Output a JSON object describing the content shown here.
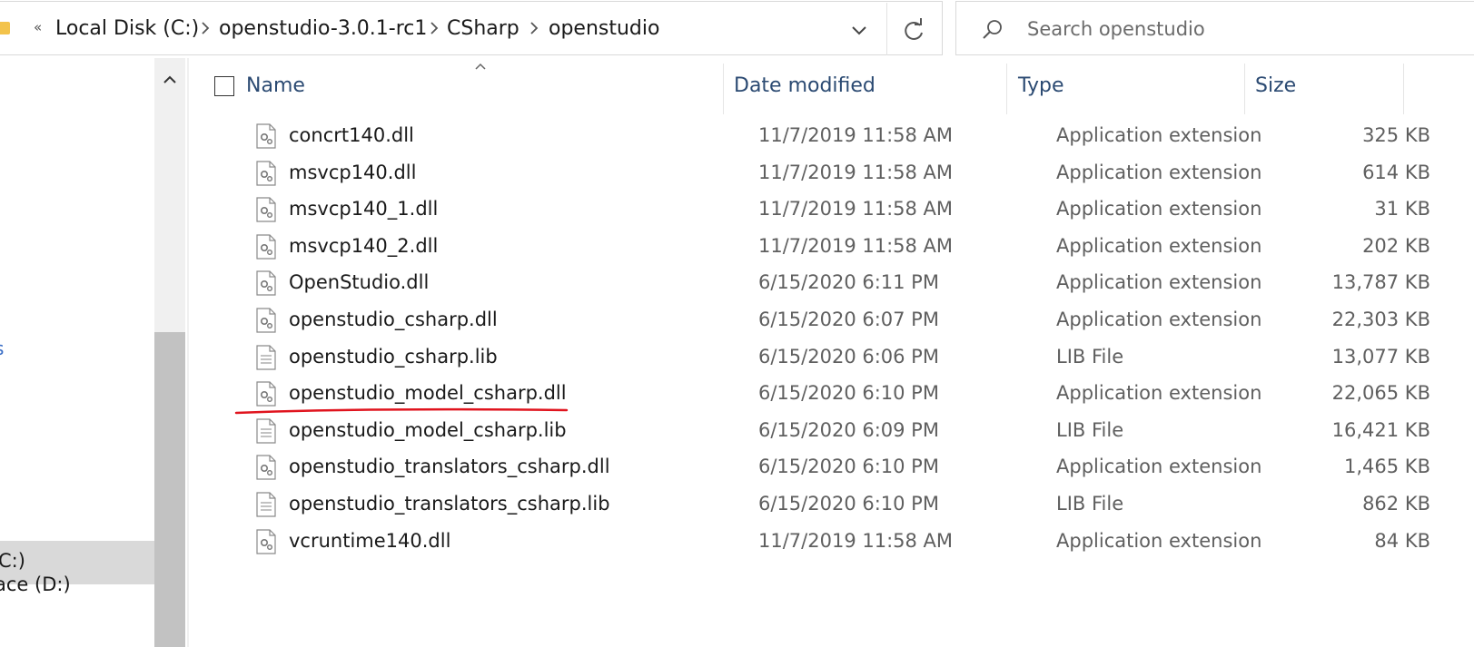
{
  "address_bar": {
    "overflow": "«",
    "breadcrumbs": [
      "Local Disk (C:)",
      "openstudio-3.0.1-rc1",
      "CSharp",
      "openstudio"
    ],
    "icons": {
      "folder": "folder-icon",
      "separator": "chevron-right-icon",
      "dropdown": "chevron-down-icon",
      "refresh": "refresh-icon"
    }
  },
  "search": {
    "placeholder": "Search openstudio",
    "value": "",
    "icon": "search-icon"
  },
  "nav_pane": {
    "fragment": "s",
    "items": [
      {
        "label": "C:)",
        "selected": true
      },
      {
        "label": "ace (D:)",
        "selected": false
      }
    ]
  },
  "file_list": {
    "columns": [
      "Name",
      "Date modified",
      "Type",
      "Size"
    ],
    "rows": [
      {
        "name": "concrt140.dll",
        "date": "11/7/2019 11:58 AM",
        "type": "Application extension",
        "size": "325 KB",
        "icon": "dll-file-icon"
      },
      {
        "name": "msvcp140.dll",
        "date": "11/7/2019 11:58 AM",
        "type": "Application extension",
        "size": "614 KB",
        "icon": "dll-file-icon"
      },
      {
        "name": "msvcp140_1.dll",
        "date": "11/7/2019 11:58 AM",
        "type": "Application extension",
        "size": "31 KB",
        "icon": "dll-file-icon"
      },
      {
        "name": "msvcp140_2.dll",
        "date": "11/7/2019 11:58 AM",
        "type": "Application extension",
        "size": "202 KB",
        "icon": "dll-file-icon"
      },
      {
        "name": "OpenStudio.dll",
        "date": "6/15/2020 6:11 PM",
        "type": "Application extension",
        "size": "13,787 KB",
        "icon": "dll-file-icon"
      },
      {
        "name": "openstudio_csharp.dll",
        "date": "6/15/2020 6:07 PM",
        "type": "Application extension",
        "size": "22,303 KB",
        "icon": "dll-file-icon"
      },
      {
        "name": "openstudio_csharp.lib",
        "date": "6/15/2020 6:06 PM",
        "type": "LIB File",
        "size": "13,077 KB",
        "icon": "lib-file-icon"
      },
      {
        "name": "openstudio_model_csharp.dll",
        "date": "6/15/2020 6:10 PM",
        "type": "Application extension",
        "size": "22,065 KB",
        "icon": "dll-file-icon"
      },
      {
        "name": "openstudio_model_csharp.lib",
        "date": "6/15/2020 6:09 PM",
        "type": "LIB File",
        "size": "16,421 KB",
        "icon": "lib-file-icon"
      },
      {
        "name": "openstudio_translators_csharp.dll",
        "date": "6/15/2020 6:10 PM",
        "type": "Application extension",
        "size": "1,465 KB",
        "icon": "dll-file-icon"
      },
      {
        "name": "openstudio_translators_csharp.lib",
        "date": "6/15/2020 6:10 PM",
        "type": "LIB File",
        "size": "862 KB",
        "icon": "lib-file-icon"
      },
      {
        "name": "vcruntime140.dll",
        "date": "11/7/2019 11:58 AM",
        "type": "Application extension",
        "size": "84 KB",
        "icon": "dll-file-icon"
      }
    ]
  },
  "annotation": {
    "underlined_row": "openstudio_model_csharp.dll",
    "color": "#e0141e"
  },
  "colors": {
    "header_text": "#2b4a72",
    "secondary_text": "#5f5f5f",
    "selection": "#d9d9d9"
  }
}
